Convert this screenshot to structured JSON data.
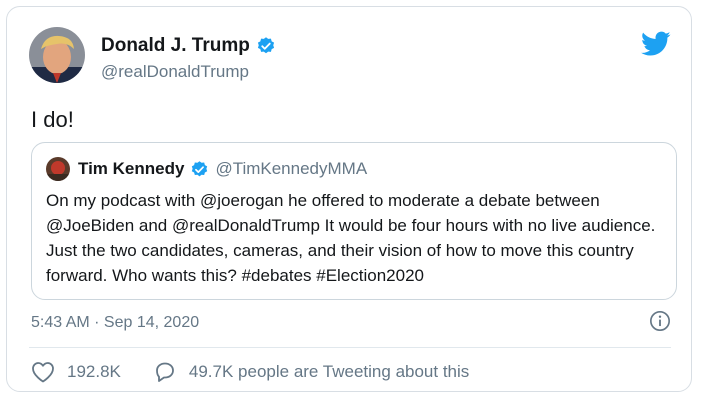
{
  "tweet": {
    "author_name": "Donald J. Trump",
    "author_handle": "@realDonaldTrump",
    "verified": true,
    "text": "I do!",
    "timestamp": "5:43 AM · Sep 14, 2020",
    "likes": "192.8K",
    "retweet_text": "49.7K people are Tweeting about this"
  },
  "quoted_tweet": {
    "author_name": "Tim Kennedy",
    "author_handle": "@TimKennedyMMA",
    "verified": true,
    "text": "On my podcast with @joerogan he offered to moderate a debate between @JoeBiden and @realDonaldTrump It would be four hours with no live audience. Just the two candidates, cameras, and their vision of how to move this country forward. Who wants this? #debates #Election2020"
  },
  "icons": {
    "brand": "twitter-bird-icon",
    "verified": "verified-badge-icon",
    "like": "heart-icon",
    "reply": "speech-bubble-icon",
    "info": "info-icon"
  },
  "colors": {
    "brand": "#1da1f2",
    "text": "#14171a",
    "secondary": "#657786",
    "border": "#ccd6dd"
  }
}
